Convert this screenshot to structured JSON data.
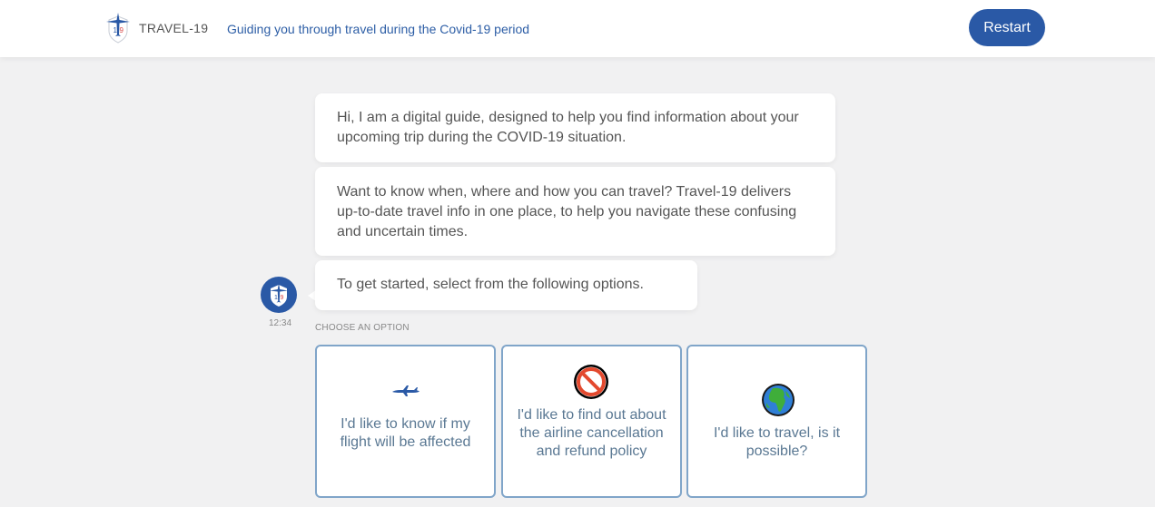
{
  "header": {
    "brand": "TRAVEL-19",
    "tagline": "Guiding you through travel during the Covid-19 period",
    "restart_label": "Restart",
    "logo_icon": "plane-shield-logo-icon"
  },
  "chat": {
    "messages": [
      "Hi, I am a digital guide, designed to help you find information about your upcoming trip during the COVID-19 situation.",
      "Want to know when, where and how you can travel? Travel-19 delivers up-to-date travel info in one place, to help you navigate these confusing and uncertain times.",
      "To get started, select from the following options."
    ],
    "timestamp": "12:34",
    "avatar_icon": "bot-avatar-icon"
  },
  "options": {
    "heading": "CHOOSE AN OPTION",
    "items": [
      {
        "icon": "airplane-icon",
        "label": "I'd like to know if my flight will be affected"
      },
      {
        "icon": "prohibited-icon",
        "label": "I'd like to find out about the airline cancellation and refund policy"
      },
      {
        "icon": "globe-icon",
        "label": "I'd like to travel, is it possible?"
      }
    ]
  },
  "colors": {
    "primary": "#2a59a6",
    "option_border": "#80a5c9",
    "option_text": "#5a7893",
    "background": "#f1f1f2"
  }
}
